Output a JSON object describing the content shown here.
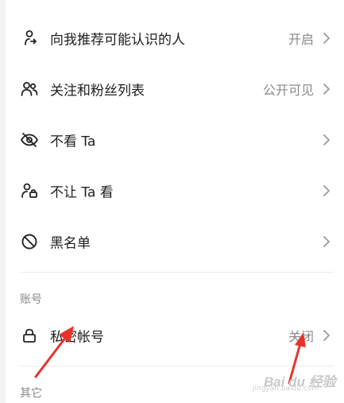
{
  "settings": [
    {
      "label": "向我推荐可能认识的人",
      "value": "开启",
      "icon": "person-recommend-icon"
    },
    {
      "label": "关注和粉丝列表",
      "value": "公开可见",
      "icon": "users-icon"
    },
    {
      "label": "不看 Ta",
      "value": "",
      "icon": "eye-off-icon"
    },
    {
      "label": "不让 Ta 看",
      "value": "",
      "icon": "person-lock-icon"
    },
    {
      "label": "黑名单",
      "value": "",
      "icon": "block-icon"
    }
  ],
  "account_section": {
    "title": "账号",
    "items": [
      {
        "label": "私密帐号",
        "value": "关闭",
        "icon": "lock-icon"
      }
    ]
  },
  "other_section": {
    "title": "其它"
  },
  "watermark": {
    "logo": "Bai du 经验",
    "sub": "jingyan.baidu.com"
  },
  "colors": {
    "annotation": "#e8332b",
    "text": "#1e1e1e",
    "secondary": "#8a8a8a"
  }
}
